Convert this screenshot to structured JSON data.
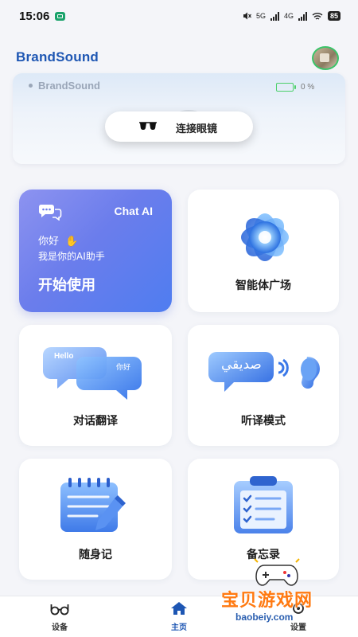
{
  "status_bar": {
    "time": "15:06",
    "network_1": "5G",
    "network_2": "4G",
    "battery": "85"
  },
  "header": {
    "brand": "BrandSound",
    "avatar_icon": "user-avatar"
  },
  "device": {
    "name": "BrandSound",
    "battery_percent": "0 %",
    "connect_label": "连接眼镜"
  },
  "tiles": {
    "chat": {
      "title": "Chat AI",
      "greeting": "你好",
      "intro": "我是你的AI助手",
      "start": "开始使用",
      "icon": "chat-bubbles-icon"
    },
    "agent": {
      "label": "智能体广场",
      "icon": "flower-orb-icon"
    },
    "translate": {
      "label": "对话翻译",
      "bubble1": "Hello",
      "bubble2": "你好",
      "icon": "translate-bubbles-icon"
    },
    "listen": {
      "label": "听译模式",
      "bubble": "صديقي",
      "icon": "ear-sound-icon"
    },
    "notes": {
      "label": "随身记",
      "icon": "notepad-pen-icon"
    },
    "memo": {
      "label": "备忘录",
      "icon": "clipboard-checklist-icon"
    }
  },
  "nav": {
    "device": "设备",
    "home": "主页",
    "settings": "设置",
    "active": "home"
  },
  "watermark": {
    "text": "宝贝游戏网",
    "url": "baobeiy.com"
  },
  "colors": {
    "brand": "#1d56b3",
    "chat_gradient_start": "#8d93f0",
    "chat_gradient_end": "#4f7df0",
    "battery_green": "#4cd06a"
  }
}
